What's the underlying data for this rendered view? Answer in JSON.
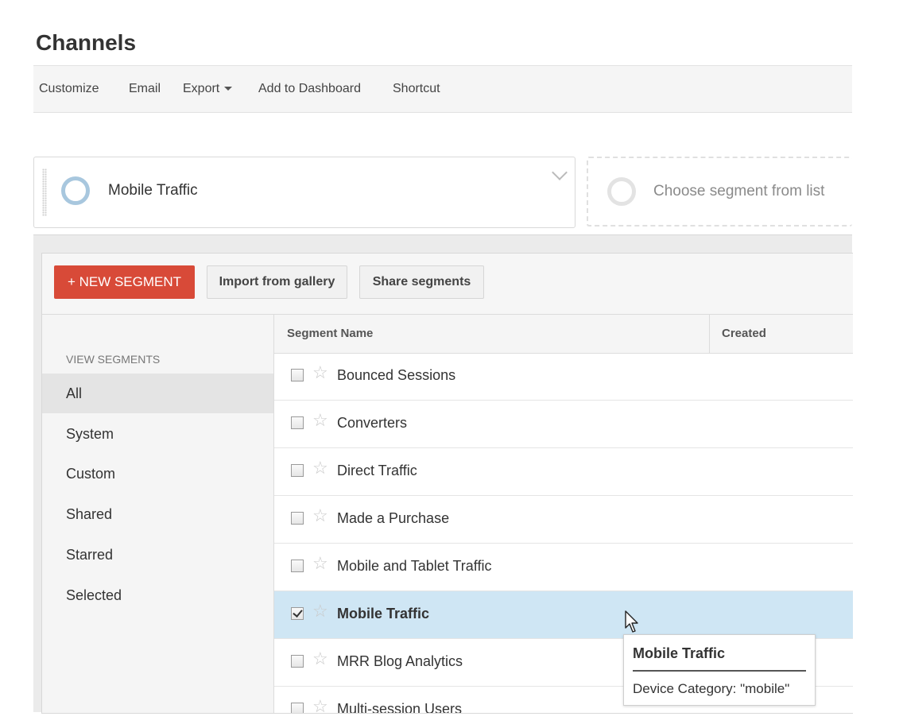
{
  "page": {
    "title": "Channels"
  },
  "toolbar": {
    "items": [
      "Customize",
      "Email",
      "Export",
      "Add to Dashboard",
      "Shortcut"
    ]
  },
  "segment_bar": {
    "active_label": "Mobile Traffic",
    "empty_label": "Choose segment from list"
  },
  "actions": {
    "new_segment": "+ NEW SEGMENT",
    "import": "Import from gallery",
    "share": "Share segments"
  },
  "sidebar": {
    "heading": "VIEW SEGMENTS",
    "items": [
      {
        "label": "All",
        "active": true
      },
      {
        "label": "System"
      },
      {
        "label": "Custom"
      },
      {
        "label": "Shared"
      },
      {
        "label": "Starred"
      },
      {
        "label": "Selected"
      }
    ]
  },
  "table": {
    "columns": [
      "Segment Name",
      "Created"
    ],
    "rows": [
      {
        "name": "Bounced Sessions",
        "checked": false
      },
      {
        "name": "Converters",
        "checked": false
      },
      {
        "name": "Direct Traffic",
        "checked": false
      },
      {
        "name": "Made a Purchase",
        "checked": false
      },
      {
        "name": "Mobile and Tablet Traffic",
        "checked": false
      },
      {
        "name": "Mobile Traffic",
        "checked": true
      },
      {
        "name": "MRR Blog Analytics",
        "checked": false
      },
      {
        "name": "Multi-session Users",
        "checked": false
      }
    ]
  },
  "tooltip": {
    "title": "Mobile Traffic",
    "text": "Device Category: \"mobile\""
  },
  "colors": {
    "new_segment_button": "#d84a38",
    "selected_row": "#cfe6f4",
    "segment_ring_active": "#a8c7de"
  },
  "icons": [
    "chevron-down-icon",
    "segment-ring-icon",
    "star-icon",
    "checkbox-icon",
    "mouse-cursor-icon"
  ]
}
